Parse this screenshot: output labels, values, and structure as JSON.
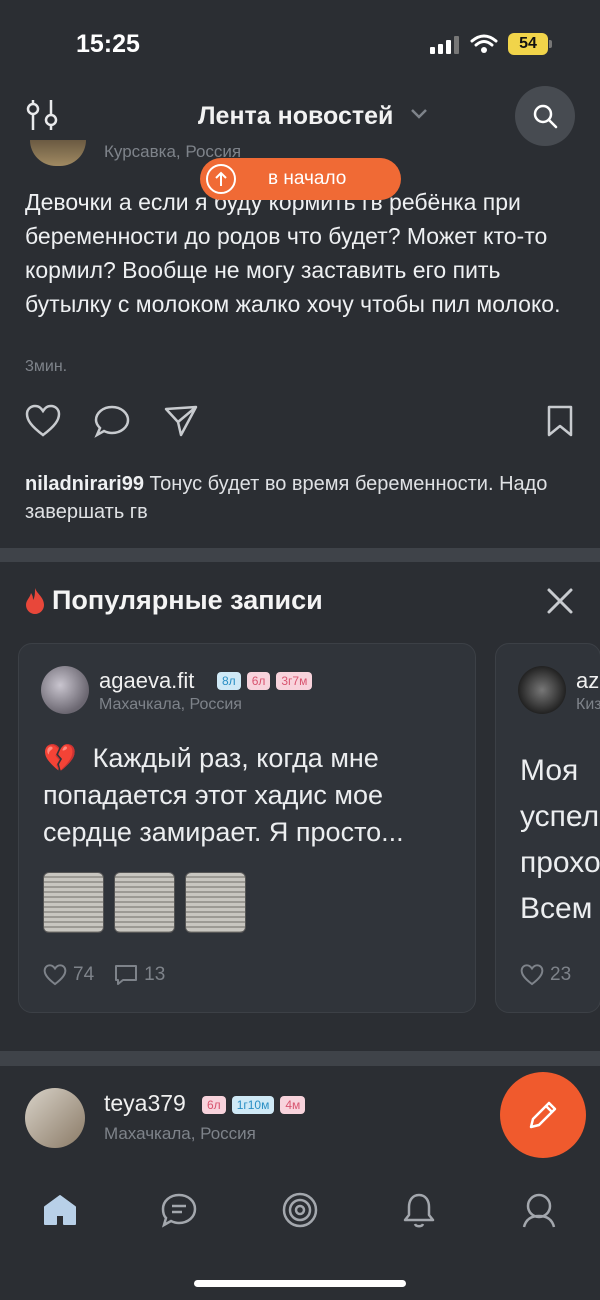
{
  "status_bar": {
    "time": "15:25",
    "battery": "54"
  },
  "header": {
    "title": "Лента новостей"
  },
  "post": {
    "location": "Курсавка, Россия",
    "text": "Девочки а если я буду кормить гв ребёнка при беременности до родов что будет? Может кто-то кормил? Вообще не могу заставить его пить бутылку с молоком жалко хочу чтобы пил молоко.",
    "time": "3мин.",
    "comment": {
      "user": "niladnirari99",
      "text": "Тонус будет во время беременности. Надо завершать гв"
    }
  },
  "to_top": {
    "label": "в начало"
  },
  "popular": {
    "title": "Популярные записи",
    "cards": [
      {
        "name": "agaeva.fit",
        "badges": [
          "8л",
          "6л",
          "3г7м"
        ],
        "location": "Махачкала, Россия",
        "emoji": "💔",
        "text": "Каждый раз, когда мне попадается этот хадис мое сердце замирает. Я просто...",
        "likes": "74",
        "comments": "13"
      },
      {
        "name": "az",
        "location": "Киз",
        "text": "Моя\nуспел\nпрохо\nВсем",
        "likes": "23"
      }
    ]
  },
  "bottom_post": {
    "name": "teya379",
    "badges": [
      "6л",
      "1г10м",
      "4м"
    ],
    "location": "Махачкала, Россия"
  },
  "colors": {
    "accent": "#f06a35",
    "background": "#2b2e33"
  }
}
